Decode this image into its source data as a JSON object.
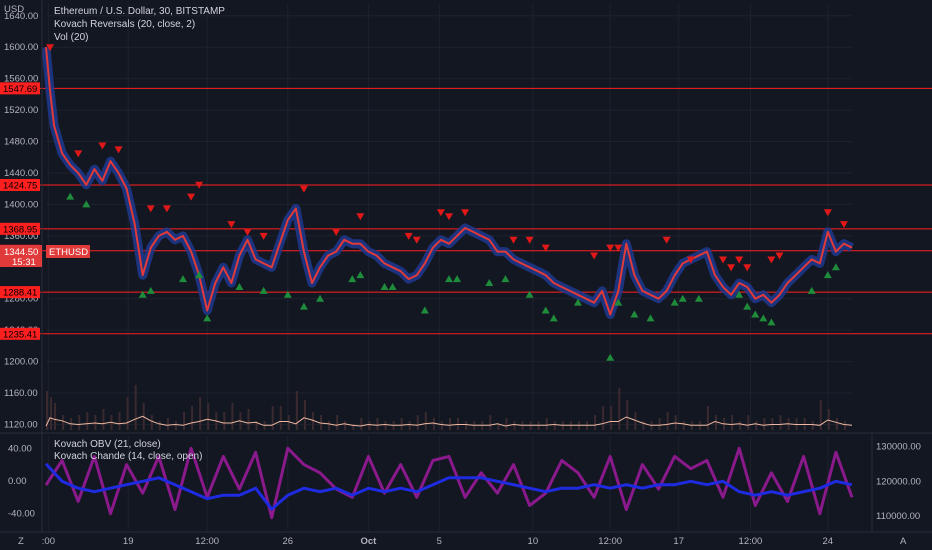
{
  "header": {
    "currency": "USD",
    "title": "Ethereum / U.S. Dollar, 30, BITSTAMP",
    "indicator1": "Kovach Reversals (20, close, 2)",
    "indicator2": "Vol (20)",
    "indicator3": "Kovach OBV (21, close)",
    "indicator4": "Kovach Chande (14, close, open)"
  },
  "price_tag": {
    "symbol": "ETHUSD",
    "price": "1344.50",
    "countdown": "15:31"
  },
  "bottom_controls": {
    "left": "Z",
    "right": "A"
  },
  "colors": {
    "background": "#131722",
    "level": "#ff1f1f",
    "price": "#e03a3a",
    "band": "#1f3a8f",
    "up": "#1e8c3a",
    "down": "#e01818",
    "osc": "#8a1a8c",
    "obv": "#1e2be0",
    "volume": "#f0b8a0"
  },
  "chart_data": [
    {
      "type": "line",
      "panel": "price",
      "y_ticks": [
        "1640.00",
        "1600.00",
        "1560.00",
        "1520.00",
        "1480.00",
        "1440.00",
        "1400.00",
        "1360.00",
        "1280.00",
        "1240.00",
        "1200.00",
        "1160.00",
        "1120.00"
      ],
      "ylim": [
        1113,
        1655
      ],
      "levels": [
        {
          "label": "1547.69",
          "value": 1547.69
        },
        {
          "label": "1424.75",
          "value": 1424.75
        },
        {
          "label": "1368.95",
          "value": 1368.95
        },
        {
          "label": "1341.04",
          "value": 1341.04
        },
        {
          "label": "1288.41",
          "value": 1288.41
        },
        {
          "label": "1235.41",
          "value": 1235.41
        }
      ],
      "x_ticks": [
        ":00",
        "19",
        "12:00",
        "26",
        "Oct",
        "5",
        "10",
        "12:00",
        "17",
        "12:00",
        "24"
      ],
      "x_tick_positions": [
        0.3,
        10.2,
        20,
        30,
        40,
        48.8,
        60.4,
        70,
        78.5,
        87.4,
        97
      ],
      "xlim": [
        0,
        100
      ],
      "series": [
        {
          "values": [
            [
              0,
              1600
            ],
            [
              0.5,
              1545
            ],
            [
              1,
              1500
            ],
            [
              2,
              1465
            ],
            [
              3,
              1450
            ],
            [
              4,
              1440
            ],
            [
              5,
              1425
            ],
            [
              6,
              1445
            ],
            [
              7,
              1430
            ],
            [
              8,
              1455
            ],
            [
              9,
              1440
            ],
            [
              10,
              1420
            ],
            [
              11,
              1375
            ],
            [
              12,
              1310
            ],
            [
              13,
              1345
            ],
            [
              14,
              1360
            ],
            [
              15,
              1365
            ],
            [
              16,
              1355
            ],
            [
              17,
              1360
            ],
            [
              18,
              1340
            ],
            [
              19,
              1310
            ],
            [
              20,
              1265
            ],
            [
              21,
              1300
            ],
            [
              22,
              1320
            ],
            [
              23,
              1300
            ],
            [
              24,
              1335
            ],
            [
              25,
              1355
            ],
            [
              26,
              1330
            ],
            [
              27,
              1325
            ],
            [
              28,
              1320
            ],
            [
              29,
              1350
            ],
            [
              30,
              1380
            ],
            [
              31,
              1395
            ],
            [
              32,
              1340
            ],
            [
              33,
              1300
            ],
            [
              34,
              1320
            ],
            [
              35,
              1335
            ],
            [
              36,
              1340
            ],
            [
              37,
              1355
            ],
            [
              38,
              1350
            ],
            [
              39,
              1350
            ],
            [
              40,
              1340
            ],
            [
              41,
              1335
            ],
            [
              42,
              1325
            ],
            [
              43,
              1320
            ],
            [
              44,
              1315
            ],
            [
              45,
              1305
            ],
            [
              46,
              1310
            ],
            [
              47,
              1325
            ],
            [
              48,
              1345
            ],
            [
              49,
              1355
            ],
            [
              50,
              1350
            ],
            [
              51,
              1360
            ],
            [
              52,
              1370
            ],
            [
              53,
              1365
            ],
            [
              54,
              1360
            ],
            [
              55,
              1355
            ],
            [
              56,
              1340
            ],
            [
              57,
              1340
            ],
            [
              58,
              1330
            ],
            [
              59,
              1325
            ],
            [
              60,
              1320
            ],
            [
              61,
              1315
            ],
            [
              62,
              1310
            ],
            [
              63,
              1300
            ],
            [
              64,
              1295
            ],
            [
              65,
              1290
            ],
            [
              66,
              1285
            ],
            [
              67,
              1280
            ],
            [
              68,
              1275
            ],
            [
              69,
              1290
            ],
            [
              70,
              1260
            ],
            [
              71,
              1290
            ],
            [
              72,
              1350
            ],
            [
              73,
              1310
            ],
            [
              74,
              1290
            ],
            [
              75,
              1285
            ],
            [
              76,
              1280
            ],
            [
              77,
              1290
            ],
            [
              78,
              1310
            ],
            [
              79,
              1325
            ],
            [
              80,
              1330
            ],
            [
              81,
              1335
            ],
            [
              82,
              1340
            ],
            [
              83,
              1310
            ],
            [
              84,
              1295
            ],
            [
              85,
              1285
            ],
            [
              86,
              1300
            ],
            [
              87,
              1295
            ],
            [
              88,
              1280
            ],
            [
              89,
              1285
            ],
            [
              90,
              1275
            ],
            [
              91,
              1285
            ],
            [
              92,
              1300
            ],
            [
              93,
              1310
            ],
            [
              94,
              1320
            ],
            [
              95,
              1330
            ],
            [
              96,
              1325
            ],
            [
              97,
              1365
            ],
            [
              98,
              1340
            ],
            [
              99,
              1350
            ],
            [
              100,
              1345
            ]
          ]
        }
      ],
      "signals_down": [
        [
          0.5,
          1600
        ],
        [
          4,
          1465
        ],
        [
          7,
          1475
        ],
        [
          9,
          1470
        ],
        [
          13,
          1395
        ],
        [
          15,
          1395
        ],
        [
          18,
          1410
        ],
        [
          19,
          1425
        ],
        [
          23,
          1375
        ],
        [
          25,
          1365
        ],
        [
          27,
          1360
        ],
        [
          32,
          1420
        ],
        [
          36,
          1365
        ],
        [
          39,
          1385
        ],
        [
          45,
          1360
        ],
        [
          46,
          1355
        ],
        [
          49,
          1390
        ],
        [
          50,
          1385
        ],
        [
          52,
          1390
        ],
        [
          58,
          1355
        ],
        [
          60,
          1355
        ],
        [
          62,
          1345
        ],
        [
          68,
          1335
        ],
        [
          70,
          1345
        ],
        [
          71,
          1345
        ],
        [
          77,
          1355
        ],
        [
          80,
          1330
        ],
        [
          84,
          1330
        ],
        [
          85,
          1320
        ],
        [
          86,
          1330
        ],
        [
          87,
          1320
        ],
        [
          90,
          1330
        ],
        [
          91,
          1335
        ],
        [
          97,
          1390
        ],
        [
          99,
          1375
        ]
      ],
      "signals_up": [
        [
          3,
          1410
        ],
        [
          5,
          1400
        ],
        [
          12,
          1285
        ],
        [
          13,
          1290
        ],
        [
          17,
          1305
        ],
        [
          19,
          1310
        ],
        [
          20,
          1255
        ],
        [
          24,
          1295
        ],
        [
          27,
          1290
        ],
        [
          30,
          1285
        ],
        [
          32,
          1270
        ],
        [
          34,
          1280
        ],
        [
          38,
          1305
        ],
        [
          39,
          1310
        ],
        [
          42,
          1295
        ],
        [
          43,
          1295
        ],
        [
          47,
          1265
        ],
        [
          50,
          1305
        ],
        [
          51,
          1305
        ],
        [
          55,
          1300
        ],
        [
          57,
          1305
        ],
        [
          60,
          1285
        ],
        [
          62,
          1265
        ],
        [
          63,
          1255
        ],
        [
          66,
          1275
        ],
        [
          70,
          1205
        ],
        [
          71,
          1275
        ],
        [
          73,
          1260
        ],
        [
          75,
          1255
        ],
        [
          78,
          1275
        ],
        [
          79,
          1280
        ],
        [
          81,
          1280
        ],
        [
          86,
          1285
        ],
        [
          87,
          1270
        ],
        [
          88,
          1260
        ],
        [
          89,
          1255
        ],
        [
          90,
          1250
        ],
        [
          95,
          1290
        ],
        [
          97,
          1310
        ],
        [
          98,
          1320
        ]
      ]
    },
    {
      "type": "line",
      "panel": "oscillator",
      "y_ticks_left": [
        "40.00",
        "0.00",
        "-40.00"
      ],
      "ylim_left": [
        -60,
        55
      ],
      "y_ticks_right": [
        "130000.00",
        "120000.00",
        "110000.00"
      ],
      "ylim_right": [
        106000,
        133000
      ],
      "series": [
        {
          "values": [
            [
              0,
              -5
            ],
            [
              2,
              25
            ],
            [
              4,
              -25
            ],
            [
              6,
              30
            ],
            [
              8,
              -40
            ],
            [
              10,
              20
            ],
            [
              12,
              -15
            ],
            [
              14,
              30
            ],
            [
              16,
              -35
            ],
            [
              18,
              40
            ],
            [
              20,
              -20
            ],
            [
              22,
              30
            ],
            [
              24,
              -10
            ],
            [
              26,
              35
            ],
            [
              28,
              -45
            ],
            [
              30,
              40
            ],
            [
              32,
              20
            ],
            [
              34,
              10
            ],
            [
              36,
              -10
            ],
            [
              38,
              -20
            ],
            [
              40,
              30
            ],
            [
              42,
              -15
            ],
            [
              44,
              20
            ],
            [
              46,
              -20
            ],
            [
              48,
              25
            ],
            [
              50,
              30
            ],
            [
              52,
              -20
            ],
            [
              54,
              10
            ],
            [
              56,
              -15
            ],
            [
              58,
              20
            ],
            [
              60,
              -30
            ],
            [
              62,
              -15
            ],
            [
              64,
              25
            ],
            [
              66,
              10
            ],
            [
              68,
              -20
            ],
            [
              70,
              30
            ],
            [
              72,
              -35
            ],
            [
              74,
              20
            ],
            [
              76,
              -10
            ],
            [
              78,
              30
            ],
            [
              80,
              15
            ],
            [
              82,
              25
            ],
            [
              84,
              -20
            ],
            [
              86,
              40
            ],
            [
              88,
              -30
            ],
            [
              90,
              10
            ],
            [
              92,
              -25
            ],
            [
              94,
              30
            ],
            [
              96,
              -40
            ],
            [
              98,
              35
            ],
            [
              100,
              -20
            ]
          ]
        },
        {
          "values": [
            [
              0,
              125000
            ],
            [
              2,
              120000
            ],
            [
              4,
              118000
            ],
            [
              6,
              117000
            ],
            [
              8,
              118000
            ],
            [
              10,
              119000
            ],
            [
              12,
              120000
            ],
            [
              14,
              121000
            ],
            [
              16,
              119000
            ],
            [
              18,
              117000
            ],
            [
              20,
              115000
            ],
            [
              22,
              116000
            ],
            [
              24,
              116000
            ],
            [
              26,
              118000
            ],
            [
              28,
              112000
            ],
            [
              30,
              116000
            ],
            [
              32,
              118000
            ],
            [
              34,
              117000
            ],
            [
              36,
              118000
            ],
            [
              38,
              116000
            ],
            [
              40,
              118000
            ],
            [
              42,
              117000
            ],
            [
              44,
              118000
            ],
            [
              46,
              117000
            ],
            [
              48,
              119000
            ],
            [
              50,
              121000
            ],
            [
              52,
              121000
            ],
            [
              54,
              121000
            ],
            [
              56,
              120000
            ],
            [
              58,
              119000
            ],
            [
              60,
              118000
            ],
            [
              62,
              117000
            ],
            [
              64,
              118000
            ],
            [
              66,
              118000
            ],
            [
              68,
              119000
            ],
            [
              70,
              118000
            ],
            [
              72,
              119000
            ],
            [
              74,
              118000
            ],
            [
              76,
              119000
            ],
            [
              78,
              119000
            ],
            [
              80,
              120000
            ],
            [
              82,
              119000
            ],
            [
              84,
              120000
            ],
            [
              86,
              117000
            ],
            [
              88,
              116000
            ],
            [
              90,
              117000
            ],
            [
              92,
              116000
            ],
            [
              94,
              117000
            ],
            [
              96,
              118000
            ],
            [
              98,
              120000
            ],
            [
              100,
              119000
            ]
          ]
        }
      ]
    }
  ]
}
